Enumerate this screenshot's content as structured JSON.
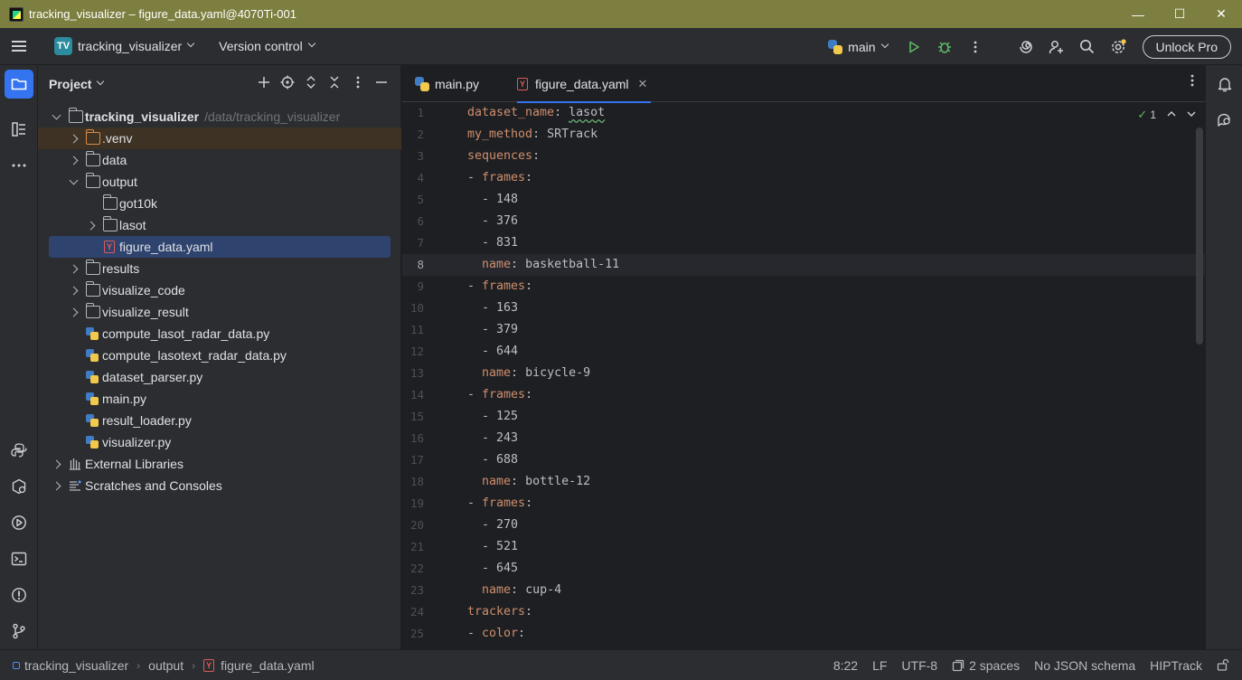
{
  "window": {
    "title": "tracking_visualizer – figure_data.yaml@4070Ti-001",
    "minimize_glyph": "—",
    "maximize_glyph": "☐",
    "close_glyph": "✕"
  },
  "toolbar": {
    "project_badge": "TV",
    "project_name": "tracking_visualizer",
    "vcs": "Version control",
    "run_config": "main",
    "unlock": "Unlock Pro"
  },
  "project_panel": {
    "title": "Project",
    "root": {
      "name": "tracking_visualizer",
      "path": "/data/tracking_visualizer"
    },
    "items": [
      ".venv",
      "data",
      "output",
      "got10k",
      "lasot",
      "figure_data.yaml",
      "results",
      "visualize_code",
      "visualize_result",
      "compute_lasot_radar_data.py",
      "compute_lasotext_radar_data.py",
      "dataset_parser.py",
      "main.py",
      "result_loader.py",
      "visualizer.py",
      "External Libraries",
      "Scratches and Consoles"
    ]
  },
  "editor": {
    "tabs": [
      "main.py",
      "figure_data.yaml"
    ],
    "active_tab": 1,
    "inspection_count": "1",
    "lines": [
      {
        "n": "1",
        "k": "dataset_name",
        "sep": ": ",
        "v": "lasot",
        "pre": ""
      },
      {
        "n": "2",
        "k": "my_method",
        "sep": ": ",
        "v": "SRTrack",
        "pre": ""
      },
      {
        "n": "3",
        "k": "sequences",
        "sep": ":",
        "v": "",
        "pre": ""
      },
      {
        "n": "4",
        "k": "frames",
        "sep": ":",
        "v": "",
        "pre": "- "
      },
      {
        "n": "5",
        "k": "",
        "sep": "",
        "v": "148",
        "pre": "  - "
      },
      {
        "n": "6",
        "k": "",
        "sep": "",
        "v": "376",
        "pre": "  - "
      },
      {
        "n": "7",
        "k": "",
        "sep": "",
        "v": "831",
        "pre": "  - "
      },
      {
        "n": "8",
        "k": "name",
        "sep": ": ",
        "v": "basketball-11",
        "pre": "  "
      },
      {
        "n": "9",
        "k": "frames",
        "sep": ":",
        "v": "",
        "pre": "- "
      },
      {
        "n": "10",
        "k": "",
        "sep": "",
        "v": "163",
        "pre": "  - "
      },
      {
        "n": "11",
        "k": "",
        "sep": "",
        "v": "379",
        "pre": "  - "
      },
      {
        "n": "12",
        "k": "",
        "sep": "",
        "v": "644",
        "pre": "  - "
      },
      {
        "n": "13",
        "k": "name",
        "sep": ": ",
        "v": "bicycle-9",
        "pre": "  "
      },
      {
        "n": "14",
        "k": "frames",
        "sep": ":",
        "v": "",
        "pre": "- "
      },
      {
        "n": "15",
        "k": "",
        "sep": "",
        "v": "125",
        "pre": "  - "
      },
      {
        "n": "16",
        "k": "",
        "sep": "",
        "v": "243",
        "pre": "  - "
      },
      {
        "n": "17",
        "k": "",
        "sep": "",
        "v": "688",
        "pre": "  - "
      },
      {
        "n": "18",
        "k": "name",
        "sep": ": ",
        "v": "bottle-12",
        "pre": "  "
      },
      {
        "n": "19",
        "k": "frames",
        "sep": ":",
        "v": "",
        "pre": "- "
      },
      {
        "n": "20",
        "k": "",
        "sep": "",
        "v": "270",
        "pre": "  - "
      },
      {
        "n": "21",
        "k": "",
        "sep": "",
        "v": "521",
        "pre": "  - "
      },
      {
        "n": "22",
        "k": "",
        "sep": "",
        "v": "645",
        "pre": "  - "
      },
      {
        "n": "23",
        "k": "name",
        "sep": ": ",
        "v": "cup-4",
        "pre": "  "
      },
      {
        "n": "24",
        "k": "trackers",
        "sep": ":",
        "v": "",
        "pre": ""
      },
      {
        "n": "25",
        "k": "color",
        "sep": ":",
        "v": "",
        "pre": "- "
      }
    ],
    "current_line": "8"
  },
  "statusbar": {
    "crumbs": [
      "tracking_visualizer",
      "output",
      "figure_data.yaml"
    ],
    "position": "8:22",
    "line_sep": "LF",
    "encoding": "UTF-8",
    "indent": "2 spaces",
    "schema": "No JSON schema",
    "branch": "HIPTrack"
  },
  "colors": {
    "accent": "#3574f0",
    "titlebar": "#7c7f3f",
    "yaml_key": "#cf8e6d",
    "selection": "#2e436e"
  }
}
